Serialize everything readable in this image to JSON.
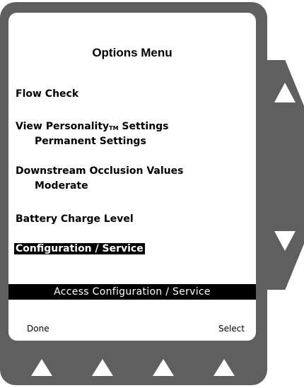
{
  "screen": {
    "title": "Options Menu",
    "menu": {
      "flow_check": "Flow Check",
      "personality_label": "View Personality",
      "personality_tm": "TM",
      "personality_suffix": " Settings",
      "personality_value": "Permanent Settings",
      "occlusion_label": "Downstream Occlusion Values",
      "occlusion_value": "Moderate",
      "battery": "Battery Charge Level",
      "configuration": "Configuration / Service"
    },
    "status_text": "Access Configuration / Service",
    "softkeys": {
      "left": "Done",
      "right": "Select"
    }
  },
  "hardware": {
    "side_up_icon": "up-arrow-icon",
    "side_down_icon": "down-arrow-icon",
    "bottom_key_icon": "up-triangle-icon"
  }
}
